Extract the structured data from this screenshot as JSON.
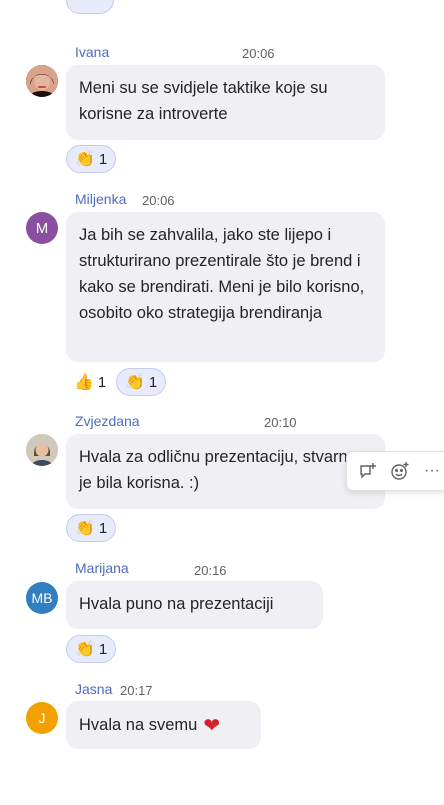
{
  "messages": [
    {
      "sender": "Ivana",
      "time": "20:06",
      "text": "Meni su se svidjele taktike koje su korisne za introverte",
      "reactions": [
        {
          "emoji": "clap-icon",
          "count": "1"
        }
      ]
    },
    {
      "sender": "Miljenka",
      "time": "20:06",
      "avatar_initials": "M",
      "text": "Ja bih se zahvalila, jako ste lijepo i strukturirano prezentirale što je brend i kako se brendirati. Meni je bilo korisno, osobito oko strategija brendiranja",
      "reactions": [
        {
          "emoji": "thumbs-up-icon",
          "count": "1"
        },
        {
          "emoji": "clap-icon",
          "count": "1"
        }
      ]
    },
    {
      "sender": "Zvjezdana",
      "time": "20:10",
      "text": "Hvala za odličnu prezentaciju, stvarno je bila korisna. :)",
      "reactions": [
        {
          "emoji": "clap-icon",
          "count": "1"
        }
      ]
    },
    {
      "sender": "Marijana",
      "time": "20:16",
      "avatar_initials": "MB",
      "text": "Hvala puno na prezentaciji",
      "reactions": [
        {
          "emoji": "clap-icon",
          "count": "1"
        }
      ]
    },
    {
      "sender": "Jasna",
      "time": "20:17",
      "avatar_initials": "J",
      "text": "Hvala na svemu",
      "text_emoji": "heart-icon"
    }
  ],
  "colors": {
    "sender": "#4f6bbd",
    "bubble": "#f0f0f4",
    "reaction_mine_bg": "#e8ebfa",
    "avatar_miljenka": "#8a4f9e",
    "avatar_marijana": "#2f7fc1",
    "avatar_jasna": "#f2a100"
  },
  "toolbar": {
    "icons": [
      "quote-reply-icon",
      "add-reaction-icon",
      "more-options-icon"
    ]
  }
}
